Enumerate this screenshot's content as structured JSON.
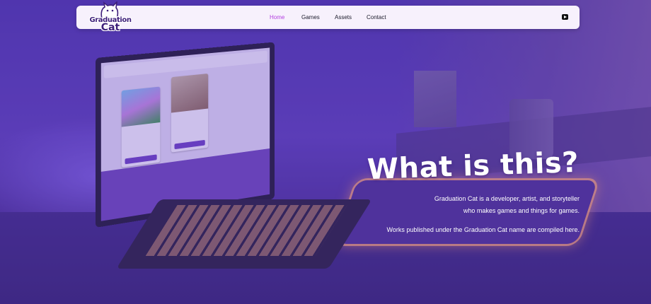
{
  "brand": {
    "line1": "Graduation",
    "line2": "Cat"
  },
  "nav": {
    "links": [
      {
        "label": "Home",
        "active": true
      },
      {
        "label": "Games",
        "active": false
      },
      {
        "label": "Assets",
        "active": false
      },
      {
        "label": "Contact",
        "active": false
      }
    ],
    "social_icon": "youtube-icon"
  },
  "hero": {
    "title": "What is this?",
    "line1": "Graduation Cat is a developer, artist, and storyteller",
    "line2": "who makes games and things for games.",
    "line3": "Works published under the Graduation Cat name are compiled here."
  },
  "colors": {
    "overlay": "#5f3cbe",
    "nav_bg": "#f7f1fc",
    "active_link": "#b23fe0",
    "logo_text": "#3e1f7a"
  }
}
